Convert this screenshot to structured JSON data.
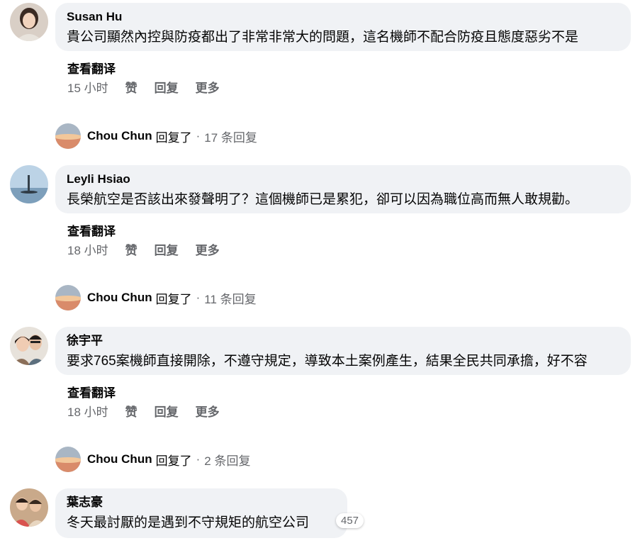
{
  "comments": [
    {
      "author": "Susan Hu",
      "text": "貴公司顯然內控與防疫都出了非常非常大的問題，這名機師不配合防疫且態度惡劣不是",
      "translate": "查看翻译",
      "time": "15 小时",
      "like": "赞",
      "reply": "回复",
      "more": "更多",
      "replies": {
        "name": "Chou Chun",
        "verb": "回复了",
        "sep": "·",
        "count": "17 条回复"
      }
    },
    {
      "author": "Leyli Hsiao",
      "text": "長榮航空是否該出來發聲明了？這個機師已是累犯，卻可以因為職位高而無人敢規勸。",
      "translate": "查看翻译",
      "time": "18 小时",
      "like": "赞",
      "reply": "回复",
      "more": "更多",
      "replies": {
        "name": "Chou Chun",
        "verb": "回复了",
        "sep": "·",
        "count": "11 条回复"
      }
    },
    {
      "author": "徐宇平",
      "text": "要求765案機師直接開除，不遵守規定，導致本土案例產生，結果全民共同承擔，好不容",
      "translate": "查看翻译",
      "time": "18 小时",
      "like": "赞",
      "reply": "回复",
      "more": "更多",
      "replies": {
        "name": "Chou Chun",
        "verb": "回复了",
        "sep": "·",
        "count": "2 条回复"
      }
    },
    {
      "author": "葉志豪",
      "text": "冬天最討厭的是遇到不守規矩的航空公司",
      "reaction_count": "457"
    }
  ],
  "colors": {
    "bubble": "#f0f2f5",
    "secondary_text": "#65676b",
    "primary_text": "#050505"
  }
}
